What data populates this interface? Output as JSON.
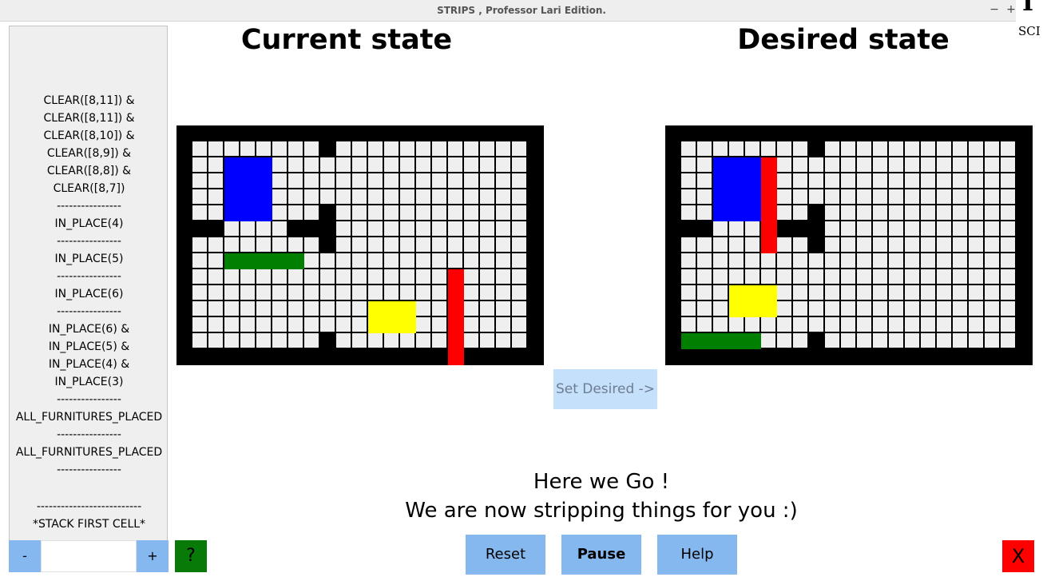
{
  "window": {
    "title": "STRIPS , Professor Lari Edition.",
    "minimize": "−",
    "maximize": "+"
  },
  "corner": {
    "glyph": "I",
    "text": "SCI"
  },
  "stack": {
    "lines": [
      "CLEAR([8,11]) &",
      "CLEAR([8,11]) &",
      "CLEAR([8,10]) &",
      "CLEAR([8,9]) &",
      "CLEAR([8,8]) &",
      "CLEAR([8,7])",
      "----------------",
      "IN_PLACE(4)",
      "----------------",
      "IN_PLACE(5)",
      "----------------",
      "IN_PLACE(6)",
      "----------------",
      "IN_PLACE(6) &",
      "IN_PLACE(5) &",
      "IN_PLACE(4) &",
      "IN_PLACE(3)",
      "----------------",
      "ALL_FURNITURES_PLACED",
      "----------------",
      "ALL_FURNITURES_PLACED",
      "----------------"
    ],
    "separator": "--------------------------",
    "first_cell_label": "*STACK FIRST CELL*",
    "minus_label": "-",
    "plus_label": "+",
    "help_label": "?"
  },
  "current": {
    "title": "Current state",
    "rows": 13,
    "cols": 21,
    "furniture": [
      {
        "name": "blue",
        "color": "#0000ff",
        "rows": [
          1,
          4
        ],
        "cols": [
          2,
          4
        ]
      },
      {
        "name": "green",
        "color": "#007f00",
        "rows": [
          7,
          7
        ],
        "cols": [
          2,
          6
        ]
      },
      {
        "name": "yellow",
        "color": "#ffff00",
        "rows": [
          10,
          11
        ],
        "cols": [
          11,
          13
        ]
      },
      {
        "name": "red",
        "color": "#ff0000",
        "rows": [
          8,
          13
        ],
        "cols": [
          16,
          16
        ]
      }
    ]
  },
  "desired": {
    "title": "Desired state",
    "rows": 13,
    "cols": 21,
    "furniture": [
      {
        "name": "blue",
        "color": "#0000ff",
        "rows": [
          1,
          4
        ],
        "cols": [
          2,
          4
        ]
      },
      {
        "name": "red",
        "color": "#ff0000",
        "rows": [
          1,
          6
        ],
        "cols": [
          5,
          5
        ]
      },
      {
        "name": "yellow",
        "color": "#ffff00",
        "rows": [
          9,
          10
        ],
        "cols": [
          3,
          5
        ]
      },
      {
        "name": "green",
        "color": "#007f00",
        "rows": [
          12,
          12
        ],
        "cols": [
          0,
          4
        ]
      }
    ]
  },
  "set_desired_label": "Set Desired ->",
  "message": {
    "line1": "Here we Go !",
    "line2": "We are now stripping things for you :)"
  },
  "buttons": {
    "reset": "Reset",
    "pause": "Pause",
    "help": "Help",
    "close": "X"
  },
  "colors": {
    "button": "#86b8f0",
    "disabled_button": "#c5e0fb",
    "floor": "#efefef",
    "wall": "#000000",
    "help_green": "#077a07",
    "close_red": "#ff0000"
  }
}
